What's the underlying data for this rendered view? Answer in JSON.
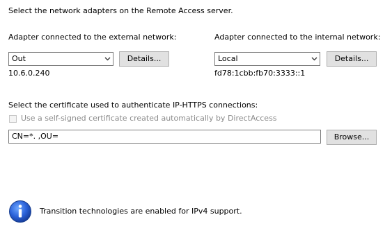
{
  "header": {
    "instruction": "Select the network adapters on the Remote Access server."
  },
  "external": {
    "label": "Adapter connected to the external network:",
    "selected": "Out",
    "details_label": "Details...",
    "address": "10.6.0.240"
  },
  "internal": {
    "label": "Adapter connected to the internal network:",
    "selected": "Local",
    "details_label": "Details...",
    "address": "fd78:1cbb:fb70:3333::1"
  },
  "certificate": {
    "label": "Select the certificate used to authenticate IP-HTTPS connections:",
    "self_signed_label": "Use a self-signed certificate created automatically by DirectAccess",
    "self_signed_checked": false,
    "value": "CN=*.                                   ,OU=                                                        ",
    "browse_label": "Browse..."
  },
  "info": {
    "icon": "info-icon",
    "text": "Transition technologies are enabled for IPv4 support."
  }
}
